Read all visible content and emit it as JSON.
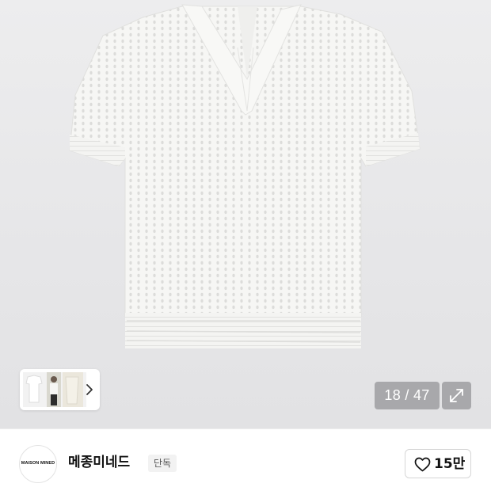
{
  "gallery": {
    "counter_current": "18",
    "counter_total": "47",
    "counter_text": "18 / 47",
    "expand_icon": "expand-arrows-icon",
    "next_icon": "chevron-right-icon",
    "image_subject": "white knit polo shirt"
  },
  "brand": {
    "logo_text": "MAISON MINED",
    "name": "메종미네드",
    "badge": "단독"
  },
  "like": {
    "icon": "heart-outline-icon",
    "count": "15만"
  }
}
